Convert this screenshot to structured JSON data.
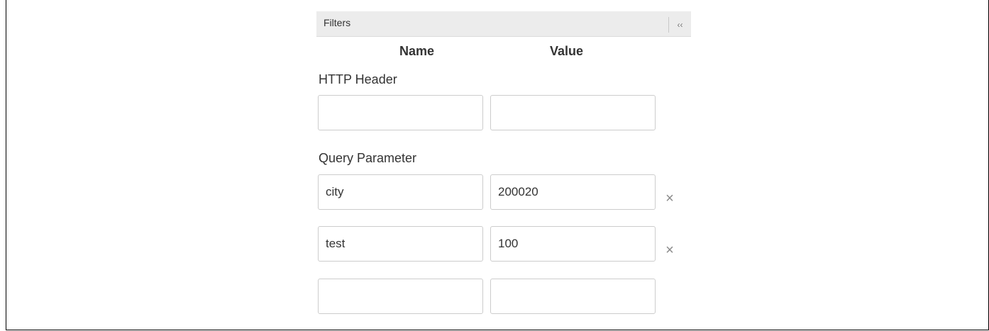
{
  "panel": {
    "title": "Filters",
    "collapse_glyph": "‹‹"
  },
  "columns": {
    "name": "Name",
    "value": "Value"
  },
  "http_header": {
    "label": "HTTP Header",
    "rows": [
      {
        "name": "",
        "value": ""
      }
    ]
  },
  "query_parameter": {
    "label": "Query Parameter",
    "rows": [
      {
        "name": "city",
        "value": "200020"
      },
      {
        "name": "test",
        "value": "100"
      },
      {
        "name": "",
        "value": ""
      }
    ]
  },
  "icons": {
    "remove": "close-icon",
    "collapse": "double-chevron-left-icon"
  },
  "remove_glyph": "×"
}
